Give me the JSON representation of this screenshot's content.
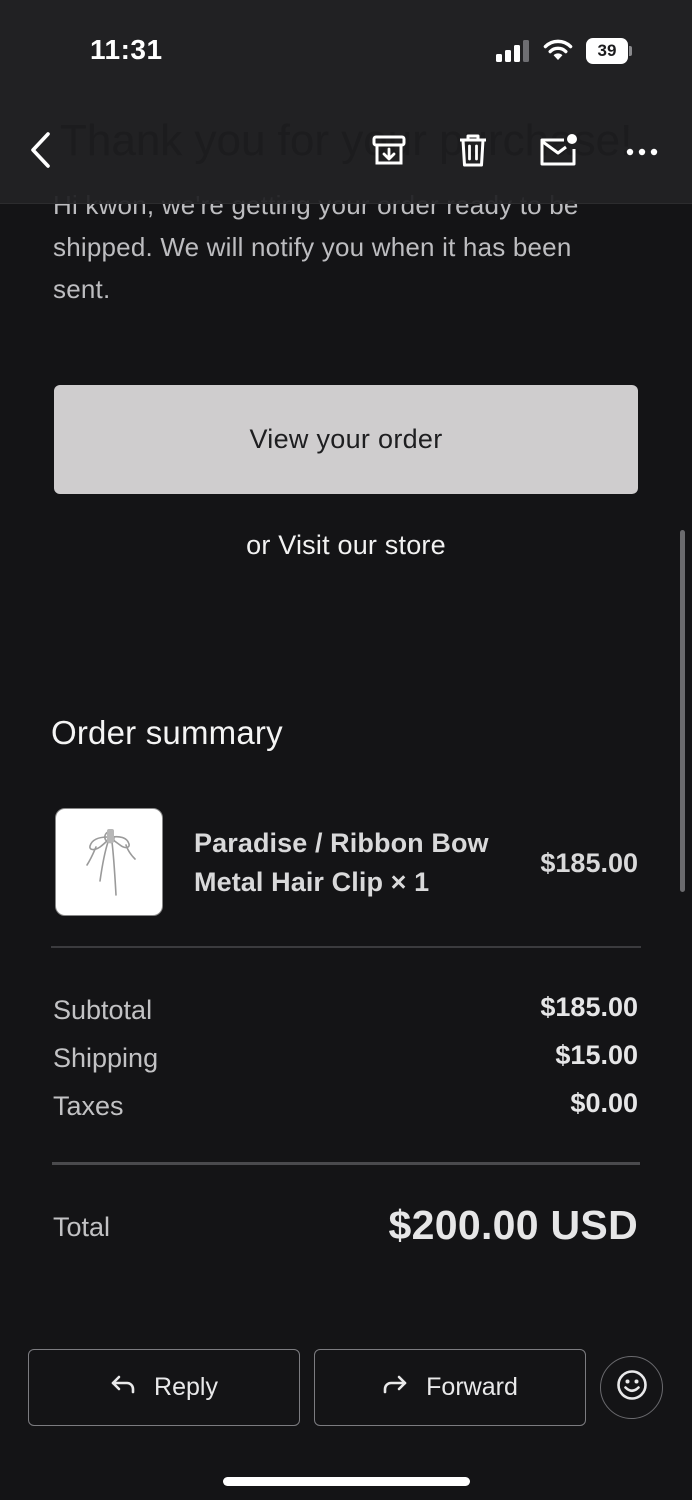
{
  "status_bar": {
    "time": "11:31",
    "battery": "39"
  },
  "header": {
    "subject_partial": "Thank you for your purchase!",
    "icons": [
      "chevron-left-icon",
      "archive-icon",
      "trash-icon",
      "mark-unread-icon",
      "more-icon"
    ]
  },
  "email": {
    "intro": "Hi kwon, we're getting your order ready to be shipped. We will notify you when it has been sent.",
    "view_order_label": "View your order",
    "visit_prefix": "or ",
    "visit_link": "Visit our store",
    "summary_title": "Order summary",
    "item": {
      "name": "Paradise / Ribbon Bow Metal Hair Clip × 1",
      "price": "$185.00"
    },
    "subtotal_label": "Subtotal",
    "subtotal_value": "$185.00",
    "shipping_label": "Shipping",
    "shipping_value": "$15.00",
    "taxes_label": "Taxes",
    "taxes_value": "$0.00",
    "total_label": "Total",
    "total_value": "$200.00 USD"
  },
  "actions": {
    "reply": "Reply",
    "forward": "Forward"
  },
  "colors": {
    "background": "#141416",
    "button_bg": "#cfcdce",
    "text_muted": "#bdbdc0"
  }
}
